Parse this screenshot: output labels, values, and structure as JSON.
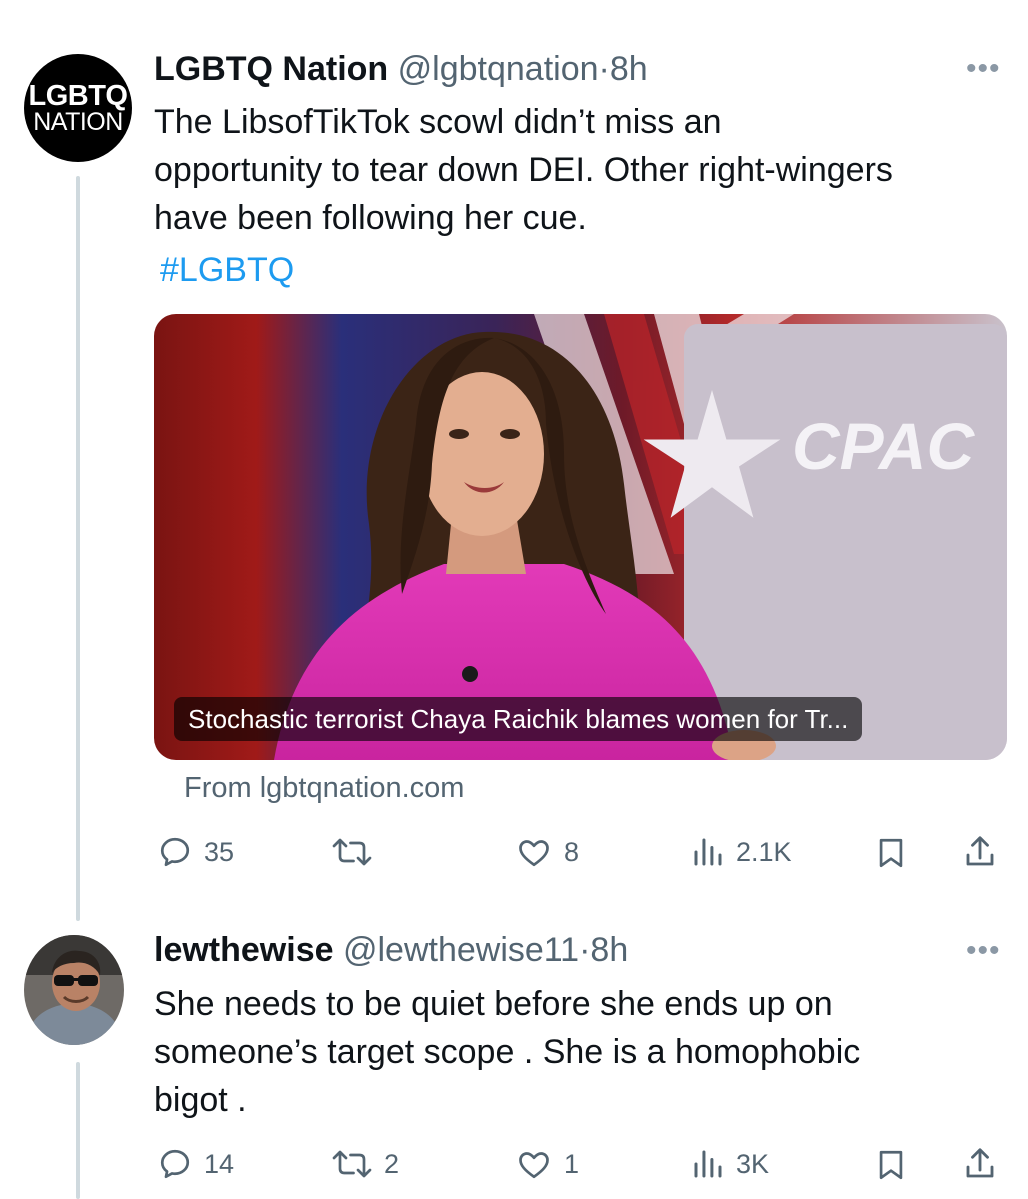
{
  "tweet1": {
    "avatar": {
      "line1": "LGBTQ",
      "line2": "NATION"
    },
    "name": "LGBTQ Nation",
    "handle": "@lgbtqnation",
    "separator": "·",
    "time": "8h",
    "more": "•••",
    "text_lines": [
      "The LibsofTikTok scowl didn’t miss an",
      "opportunity to tear down DEI. Other right-wingers",
      "have been following her cue."
    ],
    "hashtag": "#LGBTQ",
    "media": {
      "sign_text": "CPAC",
      "caption": "Stochastic terrorist Chaya Raichik blames women for Tr..."
    },
    "source": "From lgbtqnation.com",
    "stats": {
      "replies": "35",
      "retweets": "",
      "likes": "8",
      "views": "2.1K"
    }
  },
  "tweet2": {
    "name": "lewthewise",
    "handle": "@lewthewise11",
    "separator": "·",
    "time": "8h",
    "more": "•••",
    "text_lines": [
      "She needs to be quiet before she ends up on",
      "someone’s target scope . She is a homophobic",
      "bigot ."
    ],
    "stats": {
      "replies": "14",
      "retweets": "2",
      "likes": "1",
      "views": "3K"
    }
  },
  "icons": [
    "reply-icon",
    "retweet-icon",
    "like-icon",
    "views-icon",
    "bookmark-icon",
    "share-icon",
    "more-icon"
  ],
  "colors": {
    "link": "#1d9bf0",
    "secondary_text": "#536471",
    "primary_text": "#0f1419",
    "thread_line": "#cfd9de"
  }
}
